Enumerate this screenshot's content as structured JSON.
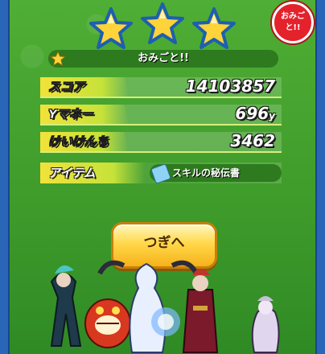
{
  "header": {
    "stars_earned": 3,
    "stars_total": 3,
    "badge_text": "おみごと!!",
    "title": "おみごと!!"
  },
  "results": {
    "score_label": "スコア",
    "score_value": "14103857",
    "money_label": "Yマネー",
    "money_value": "696",
    "money_unit": "y",
    "exp_label": "けいけんち",
    "exp_value": "3462"
  },
  "item": {
    "label": "アイテム",
    "icon": "scroll-icon",
    "name": "スキルの秘伝書"
  },
  "button": {
    "next_label": "つぎへ"
  },
  "colors": {
    "background": "#3f9a2c",
    "star": "#ffd33a",
    "button": "#ffd84a",
    "badge": "#e3222c"
  }
}
